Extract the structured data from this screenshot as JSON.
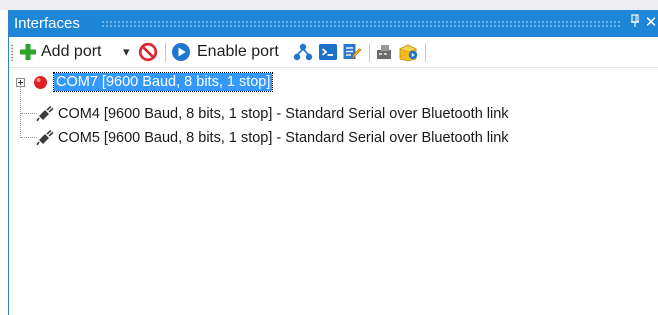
{
  "window": {
    "title": "Interfaces",
    "pin_glyph": "⫫",
    "close_glyph": "✕"
  },
  "toolbar": {
    "add_port_label": "Add port",
    "dropdown_glyph": "▾",
    "enable_port_label": "Enable port",
    "icons": [
      "add-icon",
      "dropdown-arrow-icon",
      "disable-icon",
      "enable-icon",
      "network-icon",
      "terminal-icon",
      "edit-icon",
      "device-icon",
      "package-icon"
    ]
  },
  "tree": {
    "items": [
      {
        "label": "COM7 [9600 Baud, 8 bits, 1 stop]",
        "selected": true,
        "expandable": true,
        "status": "red"
      },
      {
        "label": "COM4 [9600 Baud, 8 bits, 1 stop] - Standard Serial over Bluetooth link",
        "selected": false,
        "expandable": false,
        "status": "plug"
      },
      {
        "label": "COM5 [9600 Baud, 8 bits, 1 stop] - Standard Serial over Bluetooth link",
        "selected": false,
        "expandable": false,
        "status": "plug"
      }
    ]
  },
  "colors": {
    "titlebar": "#1e86d6",
    "selection": "#3399ff",
    "status_red": "#e02020"
  }
}
